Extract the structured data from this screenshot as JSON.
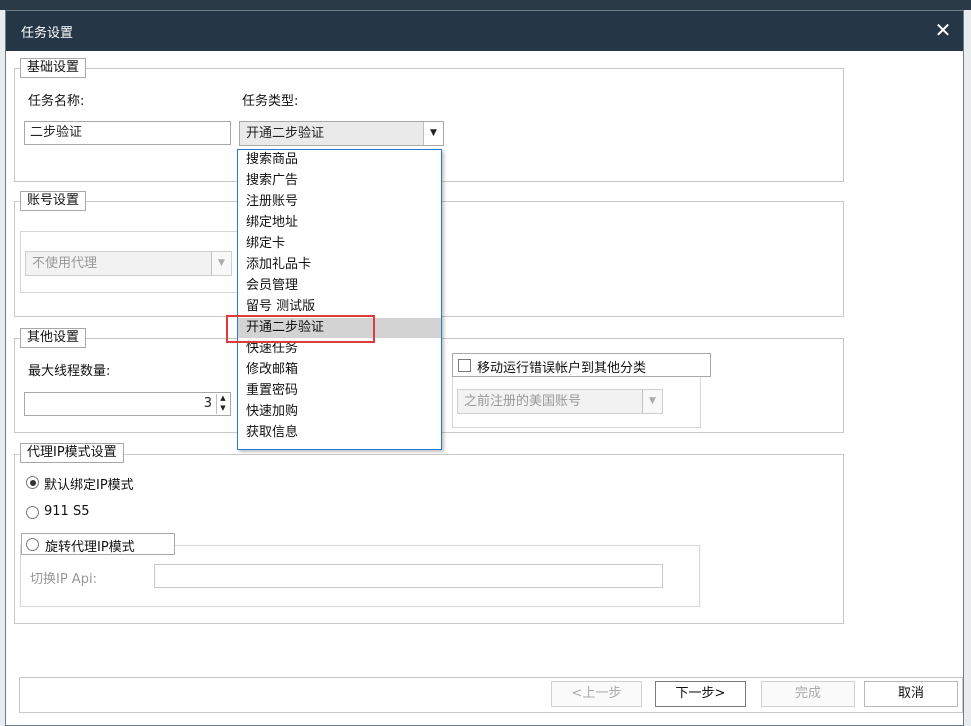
{
  "dialog": {
    "title": "任务设置",
    "close_glyph": "✕"
  },
  "basic": {
    "legend": "基础设置",
    "task_name_label": "任务名称:",
    "task_name_value": "二步验证",
    "task_type_label": "任务类型:",
    "task_type_value": "开通二步验证"
  },
  "account": {
    "legend": "账号设置",
    "proxy_select_value": "不使用代理"
  },
  "other": {
    "legend": "其他设置",
    "max_threads_label": "最大线程数量:",
    "max_threads_value": "3",
    "move_error_label": "移动运行错误帐户到其他分类",
    "category_select_value": "之前注册的美国账号"
  },
  "proxy_mode": {
    "legend": "代理IP模式设置",
    "option_default": "默认绑定IP模式",
    "option_911": "911 S5",
    "option_rotate": "旋转代理IP模式",
    "switch_api_label": "切换IP Api:",
    "switch_api_value": ""
  },
  "task_type_dropdown": {
    "items": [
      "搜索商品",
      "搜索广告",
      "注册账号",
      "绑定地址",
      "绑定卡",
      "添加礼品卡",
      "会员管理",
      "留号 测试版",
      "开通二步验证",
      "快速任务",
      "修改邮箱",
      "重置密码",
      "快速加购",
      "获取信息"
    ],
    "selected_index": 8
  },
  "footer": {
    "prev_label": "<上一步",
    "next_label": "下一步>",
    "finish_label": "完成",
    "cancel_label": "取消"
  },
  "colors": {
    "titlebar": "#253746",
    "highlight_border": "#e03b3b",
    "dropdown_border": "#2a7bd3"
  }
}
